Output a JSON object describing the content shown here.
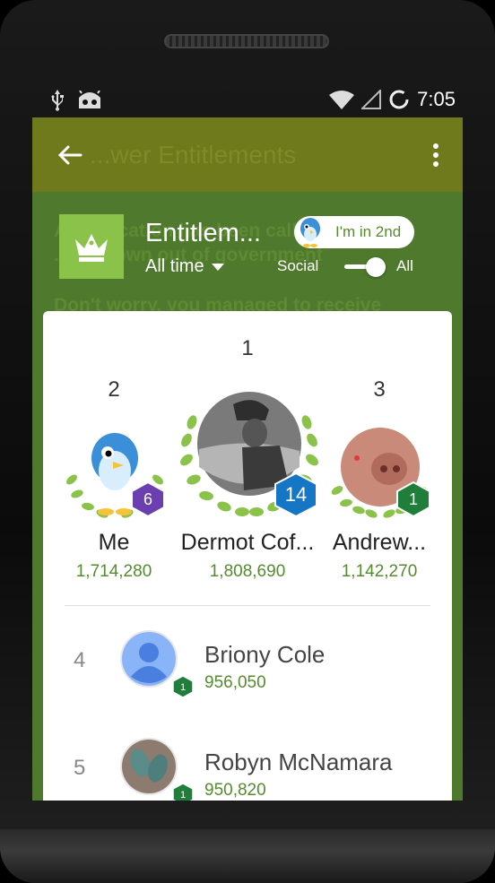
{
  "status": {
    "time": "7:05"
  },
  "appbar": {
    "ghost_title": "...wer Entitlements"
  },
  "ghost": {
    "line1": "A notification has been called...",
    "line2": "...ve grown out of government",
    "line3": "Don't worry, you managed to receive"
  },
  "leaderboard": {
    "title": "Entitlem...",
    "timeframe": "All time",
    "rank_pill": "I'm in 2nd",
    "social_label": "Social",
    "all_label": "All",
    "accent": "#558b2f"
  },
  "podium": [
    {
      "place": "2",
      "name": "Me",
      "score": "1,714,280",
      "level": "6",
      "level_color": "#6a3fb0"
    },
    {
      "place": "1",
      "name": "Dermot Cof...",
      "score": "1,808,690",
      "level": "14",
      "level_color": "#1476c4"
    },
    {
      "place": "3",
      "name": "Andrew...",
      "score": "1,142,270",
      "level": "1",
      "level_color": "#1f7f3a"
    }
  ],
  "rows": [
    {
      "rank": "4",
      "name": "Briony Cole",
      "score": "956,050",
      "level": "1"
    },
    {
      "rank": "5",
      "name": "Robyn McNamara",
      "score": "950,820",
      "level": "1"
    }
  ]
}
